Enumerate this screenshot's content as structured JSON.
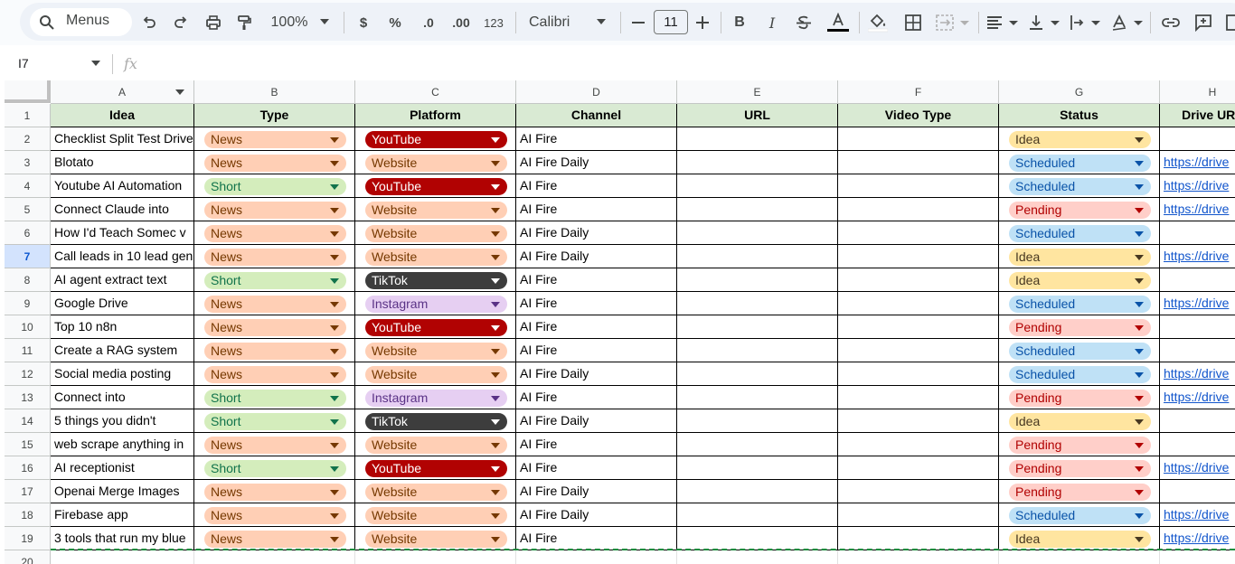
{
  "toolbar": {
    "menus_label": "Menus",
    "zoom": "100%",
    "currency": "$",
    "percent": "%",
    "dec_decrease": ".0",
    "dec_increase": ".00",
    "number_format": "123",
    "font": "Calibri",
    "font_size": "11",
    "bold": "B",
    "italic": "I"
  },
  "formula_bar": {
    "cell_ref": "I7",
    "fx": "fx"
  },
  "columns": [
    "A",
    "B",
    "C",
    "D",
    "E",
    "F",
    "G",
    "H"
  ],
  "headers": [
    "Idea",
    "Type",
    "Platform",
    "Channel",
    "URL",
    "Video Type",
    "Status",
    "Drive URL"
  ],
  "rows": [
    {
      "num": "2",
      "idea": "Checklist Split Test Drive",
      "type": "News",
      "platform": "YouTube",
      "channel": "AI Fire",
      "status": "Idea",
      "drive": ""
    },
    {
      "num": "3",
      "idea": "Blotato",
      "type": "News",
      "platform": "Website",
      "channel": "AI Fire Daily",
      "status": "Scheduled",
      "drive": "https://drive"
    },
    {
      "num": "4",
      "idea": "Youtube AI Automation",
      "type": "Short",
      "platform": "YouTube",
      "channel": "AI Fire",
      "status": "Scheduled",
      "drive": "https://drive"
    },
    {
      "num": "5",
      "idea": "Connect Claude into",
      "type": "News",
      "platform": "Website",
      "channel": "AI Fire",
      "status": "Pending",
      "drive": "https://drive"
    },
    {
      "num": "6",
      "idea": "How I'd Teach Somec v",
      "type": "News",
      "platform": "Website",
      "channel": "AI Fire Daily",
      "status": "Scheduled",
      "drive": ""
    },
    {
      "num": "7",
      "idea": "Call leads in 10 lead gen",
      "type": "News",
      "platform": "Website",
      "channel": "AI Fire Daily",
      "status": "Idea",
      "drive": "https://drive"
    },
    {
      "num": "8",
      "idea": "AI agent extract text",
      "type": "Short",
      "platform": "TikTok",
      "channel": "AI Fire",
      "status": "Idea",
      "drive": ""
    },
    {
      "num": "9",
      "idea": "Google Drive",
      "type": "News",
      "platform": "Instagram",
      "channel": "AI Fire",
      "status": "Scheduled",
      "drive": "https://drive"
    },
    {
      "num": "10",
      "idea": "Top 10 n8n",
      "type": "News",
      "platform": "YouTube",
      "channel": "AI Fire",
      "status": "Pending",
      "drive": ""
    },
    {
      "num": "11",
      "idea": "Create a RAG system",
      "type": "News",
      "platform": "Website",
      "channel": "AI Fire",
      "status": "Scheduled",
      "drive": ""
    },
    {
      "num": "12",
      "idea": "Social media posting",
      "type": "News",
      "platform": "Website",
      "channel": "AI Fire Daily",
      "status": "Scheduled",
      "drive": "https://drive"
    },
    {
      "num": "13",
      "idea": "Connect into",
      "type": "Short",
      "platform": "Instagram",
      "channel": "AI Fire",
      "status": "Pending",
      "drive": "https://drive"
    },
    {
      "num": "14",
      "idea": "5 things you didn't",
      "type": "Short",
      "platform": "TikTok",
      "channel": "AI Fire Daily",
      "status": "Idea",
      "drive": ""
    },
    {
      "num": "15",
      "idea": "web scrape anything in",
      "type": "News",
      "platform": "Website",
      "channel": "AI Fire",
      "status": "Pending",
      "drive": ""
    },
    {
      "num": "16",
      "idea": "AI receptionist",
      "type": "Short",
      "platform": "YouTube",
      "channel": "AI Fire",
      "status": "Pending",
      "drive": "https://drive"
    },
    {
      "num": "17",
      "idea": "Openai Merge Images",
      "type": "News",
      "platform": "Website",
      "channel": "AI Fire Daily",
      "status": "Pending",
      "drive": ""
    },
    {
      "num": "18",
      "idea": "Firebase app",
      "type": "News",
      "platform": "Website",
      "channel": "AI Fire Daily",
      "status": "Scheduled",
      "drive": "https://drive"
    },
    {
      "num": "19",
      "idea": "3 tools that run my blue",
      "type": "News",
      "platform": "Website",
      "channel": "AI Fire",
      "status": "Idea",
      "drive": "https://drive"
    }
  ],
  "header_row_num": "1",
  "last_row_num": "20",
  "active_row": "7"
}
